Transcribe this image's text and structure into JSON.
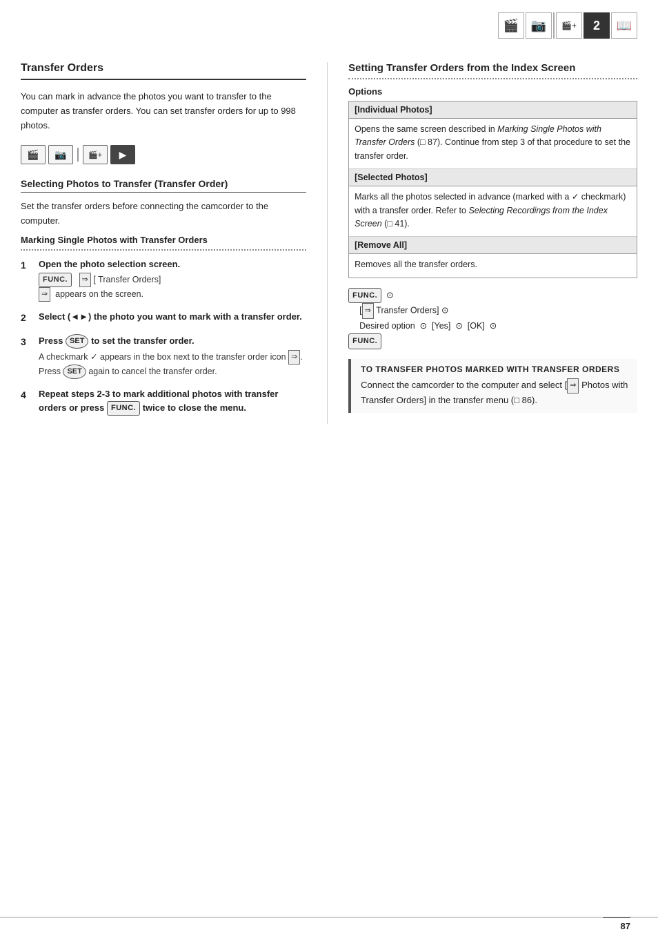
{
  "topIcons": [
    {
      "symbol": "🎬",
      "label": "video-icon",
      "active": false
    },
    {
      "symbol": "📷",
      "label": "photo-icon",
      "active": false
    },
    {
      "symbol": "◇",
      "label": "diamond-icon",
      "active": false
    },
    {
      "symbol": "2",
      "label": "number-two",
      "active": true
    },
    {
      "symbol": "📖",
      "label": "book-icon",
      "active": false
    }
  ],
  "left": {
    "sectionTitle": "Transfer Orders",
    "introText": "You can mark in advance the photos you want to transfer to the computer as transfer orders. You can set transfer orders for up to 998 photos.",
    "modeIcons": [
      "🎬",
      "📷",
      "🎬+",
      "▶"
    ],
    "subsectionTitle": "Selecting Photos to Transfer (Transfer Order)",
    "preamble": "Set the transfer orders before connecting the camcorder to the computer.",
    "subSubTitle": "Marking Single Photos with Transfer Orders",
    "steps": [
      {
        "num": "1",
        "title": "Open the photo selection screen.",
        "detail": "[FUNC.]  [  Transfer Orders]   appears on the screen."
      },
      {
        "num": "2",
        "title": "Select (◄►) the photo you want to mark with a transfer order.",
        "detail": ""
      },
      {
        "num": "3",
        "title": "Press SET to set the transfer order.",
        "detail": "A checkmark ✓ appears in the box next to the transfer order icon  . Press SET again to cancel the transfer order."
      },
      {
        "num": "4",
        "title": "Repeat steps 2-3 to mark additional photos with transfer orders or press FUNC. twice to close the menu.",
        "detail": ""
      }
    ]
  },
  "right": {
    "sectionTitle": "Setting Transfer Orders from the Index Screen",
    "optionsTitle": "Options",
    "options": [
      {
        "header": "[Individual Photos]",
        "desc": "Opens the same screen described in Marking Single Photos with Transfer Orders (□ 87). Continue from step 3 of that procedure to set the transfer order."
      },
      {
        "header": "[Selected Photos]",
        "desc": "Marks all the photos selected in advance (marked with a ✓ checkmark) with a transfer order. Refer to Selecting Recordings from the Index Screen (□ 41)."
      },
      {
        "header": "[Remove All]",
        "desc": "Removes all the transfer orders."
      }
    ],
    "instruction": {
      "line1": "FUNC.",
      "line2": "[ Transfer Orders]",
      "line3": "Desired option  [Yes]  [OK]",
      "line4": "FUNC."
    },
    "toTransfer": {
      "title": "To transfer photos marked with transfer orders",
      "text": "Connect the camcorder to the computer and select [  Photos with Transfer Orders] in the transfer menu (□ 86)."
    }
  },
  "pageNumber": "87"
}
